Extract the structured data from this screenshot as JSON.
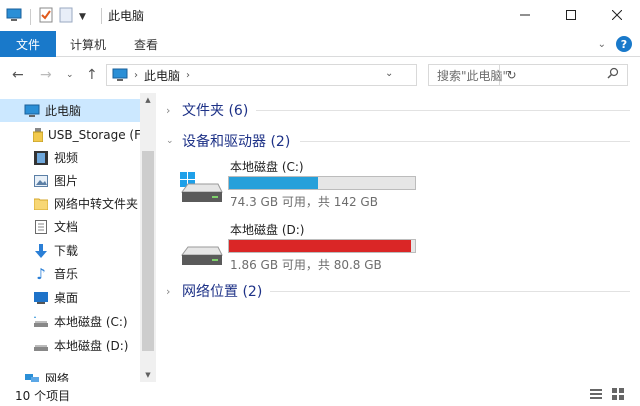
{
  "window": {
    "title": "此电脑",
    "minimize_icon": "minimize-icon",
    "maximize_icon": "maximize-icon",
    "close_icon": "close-icon"
  },
  "ribbon": {
    "file_tab": "文件",
    "tabs": [
      "计算机",
      "查看"
    ],
    "accent": "#1979ca",
    "help": "?"
  },
  "address": {
    "location": "此电脑",
    "search_placeholder": "搜索\"此电脑\""
  },
  "nav_pane": {
    "items": [
      {
        "label": "此电脑",
        "icon": "computer-icon",
        "selected": true
      },
      {
        "label": "USB_Storage (F",
        "icon": "usb-drive-icon"
      },
      {
        "label": "视频",
        "icon": "video-icon"
      },
      {
        "label": "图片",
        "icon": "pictures-icon"
      },
      {
        "label": "网络中转文件夹",
        "icon": "folder-icon"
      },
      {
        "label": "文档",
        "icon": "documents-icon"
      },
      {
        "label": "下载",
        "icon": "download-icon"
      },
      {
        "label": "音乐",
        "icon": "music-icon"
      },
      {
        "label": "桌面",
        "icon": "desktop-icon"
      },
      {
        "label": "本地磁盘 (C:)",
        "icon": "drive-icon"
      },
      {
        "label": "本地磁盘 (D:)",
        "icon": "drive-icon"
      },
      {
        "label": "网络",
        "icon": "network-icon"
      }
    ]
  },
  "content": {
    "groups": {
      "folders": "文件夹 (6)",
      "devices": "设备和驱动器 (2)",
      "network": "网络位置 (2)"
    },
    "drives": [
      {
        "name": "本地磁盘 (C:)",
        "info": "74.3 GB 可用，共 142 GB",
        "used_fraction": 0.477,
        "bar_color": "#26a0da"
      },
      {
        "name": "本地磁盘 (D:)",
        "info": "1.86 GB 可用，共 80.8 GB",
        "used_fraction": 0.977,
        "bar_color": "#da2626"
      }
    ]
  },
  "status": {
    "item_count": "10 个项目"
  }
}
